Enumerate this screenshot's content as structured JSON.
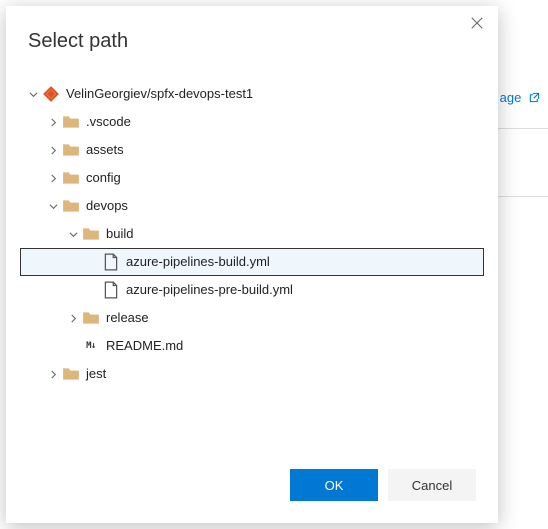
{
  "background": {
    "link_text": "age"
  },
  "modal": {
    "title": "Select path",
    "ok_label": "OK",
    "cancel_label": "Cancel"
  },
  "tree": {
    "repo": "VelinGeorgiev/spfx-devops-test1",
    "vscode": ".vscode",
    "assets": "assets",
    "config": "config",
    "devops": "devops",
    "build": "build",
    "file_build": "azure-pipelines-build.yml",
    "file_prebuild": "azure-pipelines-pre-build.yml",
    "release": "release",
    "readme": "README.md",
    "jest": "jest"
  }
}
